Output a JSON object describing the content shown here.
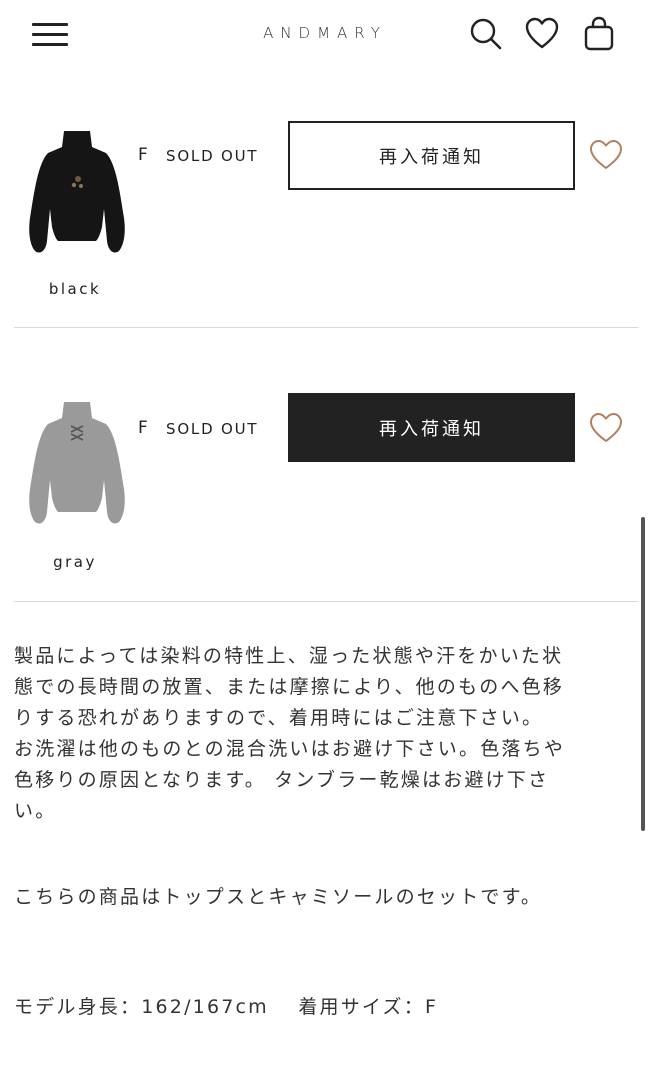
{
  "header": {
    "logo": "ANDMARY",
    "icons": [
      "hamburger-menu-icon",
      "search-icon",
      "heart-icon",
      "shopping-bag-icon"
    ]
  },
  "variants": [
    {
      "color": "black",
      "size": "F",
      "stock_status": "SOLD OUT",
      "button_label": "再入荷通知",
      "button_style": "outline",
      "garment_color": "#151515"
    },
    {
      "color": "gray",
      "size": "F",
      "stock_status": "SOLD OUT",
      "button_label": "再入荷通知",
      "button_style": "filled",
      "garment_color": "#9a9a9a"
    }
  ],
  "description": {
    "care_lines": [
      "製品によっては染料の特性上、湿った状態や汗をかいた状",
      "態での長時間の放置、または摩擦により、他のものへ色移",
      "りする恐れがありますので、着用時にはご注意下さい。",
      "お洗濯は他のものとの混合洗いはお避け下さい。色落ちや",
      "色移りの原因となります。 タンブラー乾燥はお避け下さ",
      "い。"
    ],
    "set_note": "こちらの商品はトップスとキャミソールのセットです。",
    "model_info": "モデル身長：162/167cm　 着用サイズ：F"
  },
  "colors": {
    "text": "#222222",
    "heart_accent": "#b08060",
    "divider": "#d9d9d9",
    "button_dark": "#222222"
  }
}
